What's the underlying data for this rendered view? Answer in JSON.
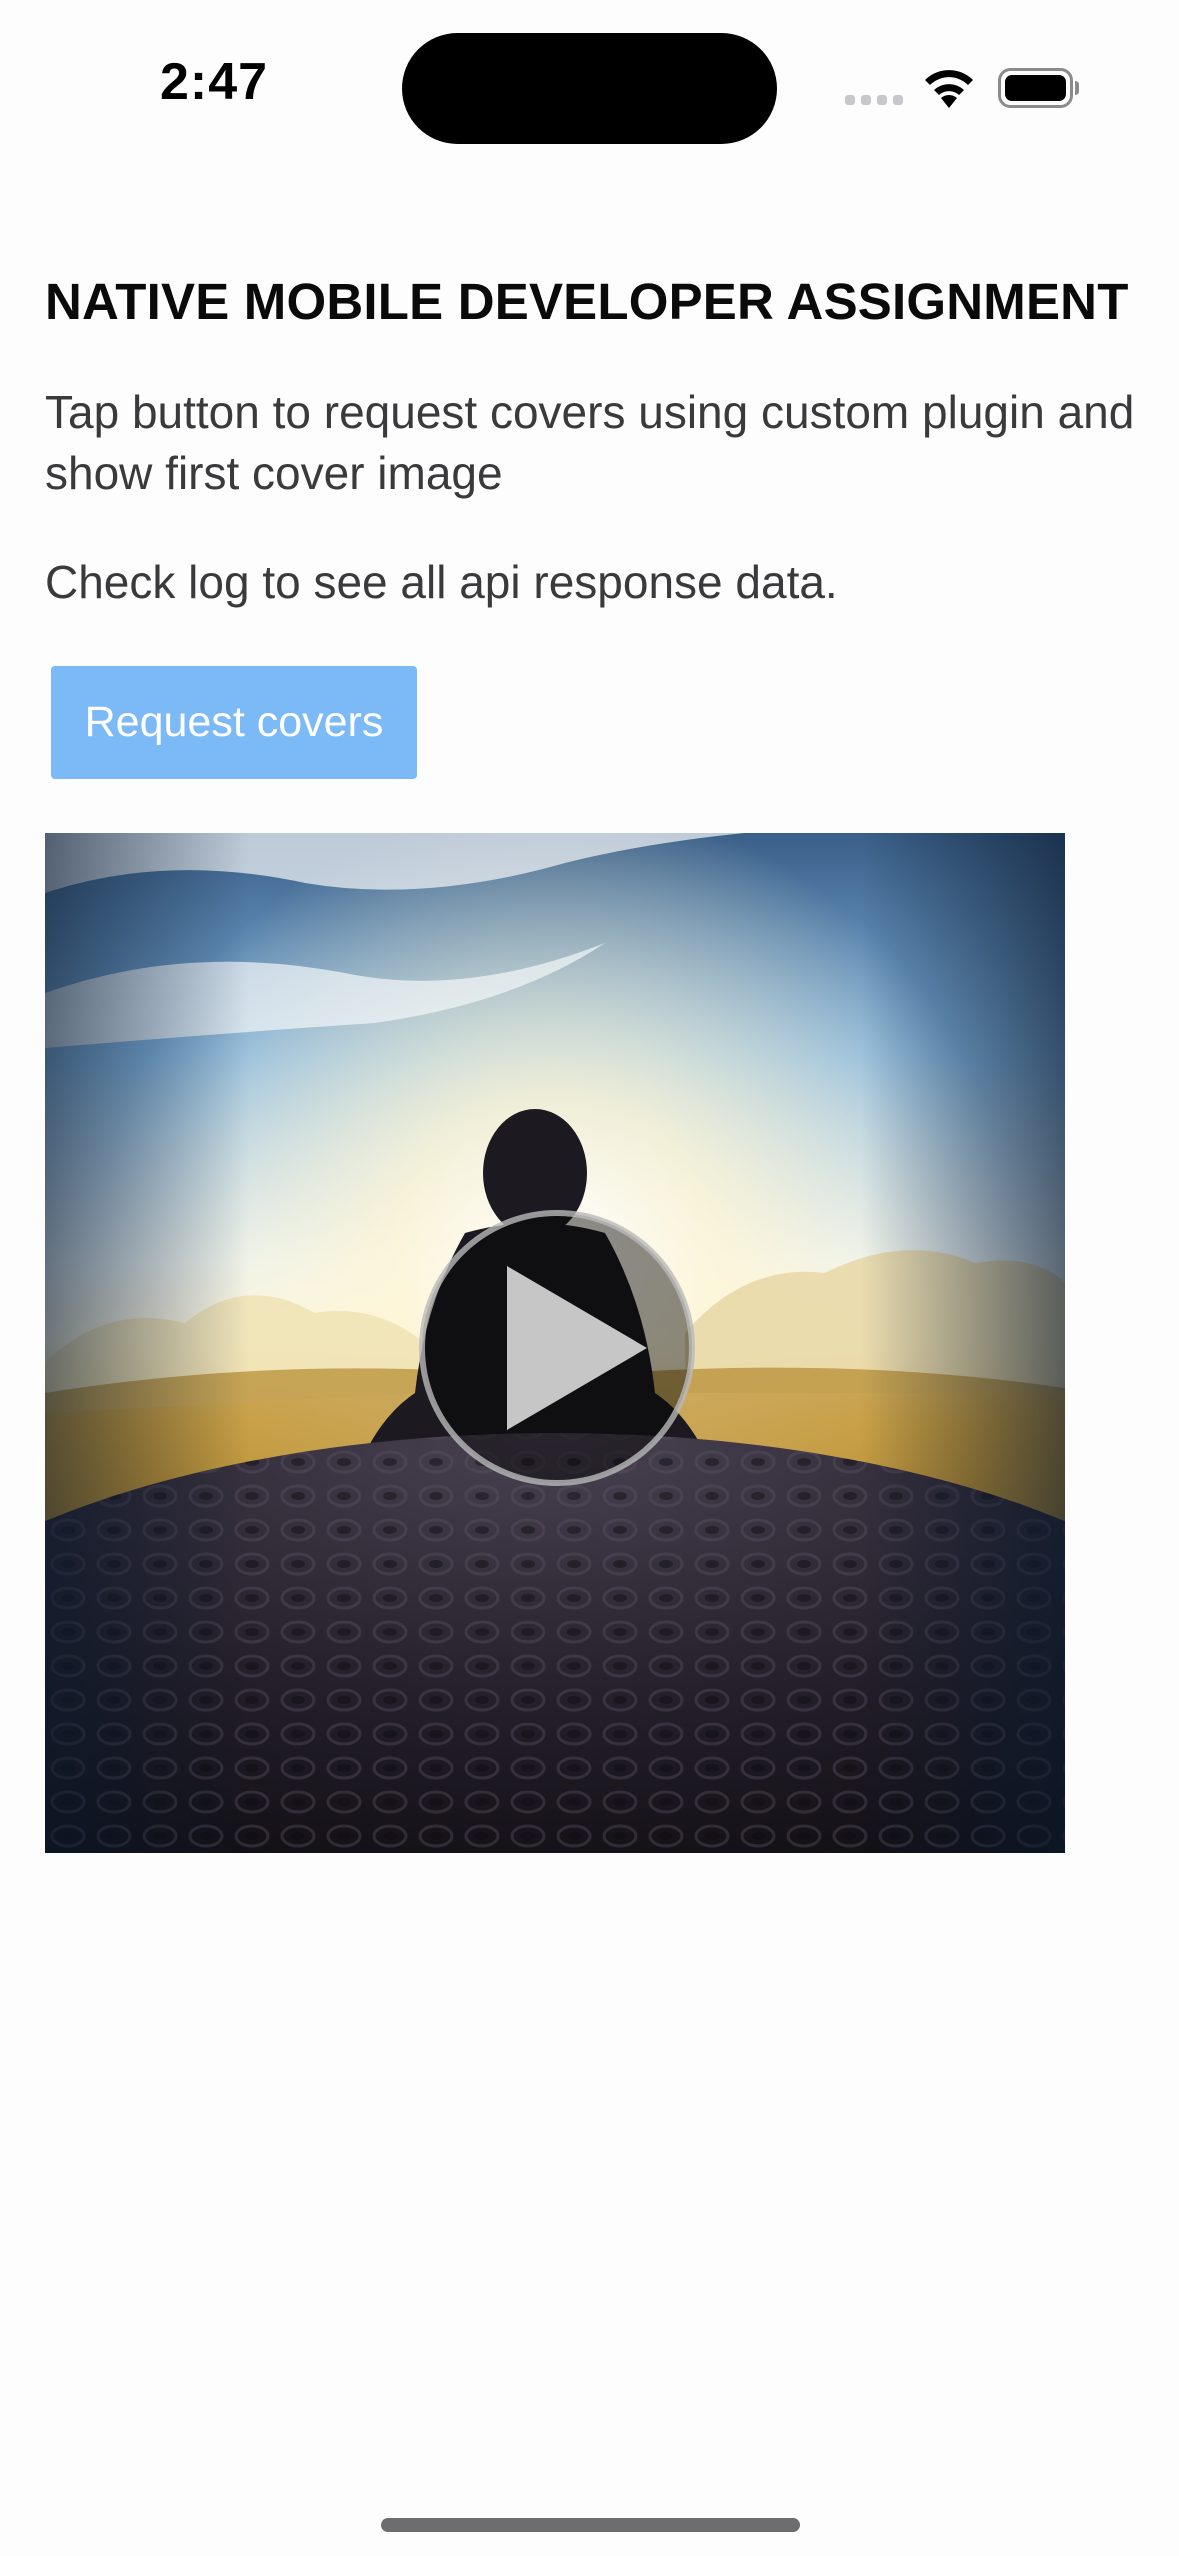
{
  "status_bar": {
    "time": "2:47",
    "icons": [
      "cellular-signal-icon",
      "wifi-icon",
      "battery-icon"
    ]
  },
  "main": {
    "title": "NATIVE MOBILE DEVELOPER ASSIGNMENT",
    "description": "Tap button to request covers using custom plugin and show first cover image",
    "log_hint": "Check log to see all api response data.",
    "request_button_label": "Request covers",
    "cover_image": {
      "overlay_icon": "play-icon"
    }
  },
  "colors": {
    "button_background": "#7cb9f7",
    "button_text": "#ffffff",
    "title_text": "#0a0a0a",
    "body_text": "#3a3a3c"
  }
}
